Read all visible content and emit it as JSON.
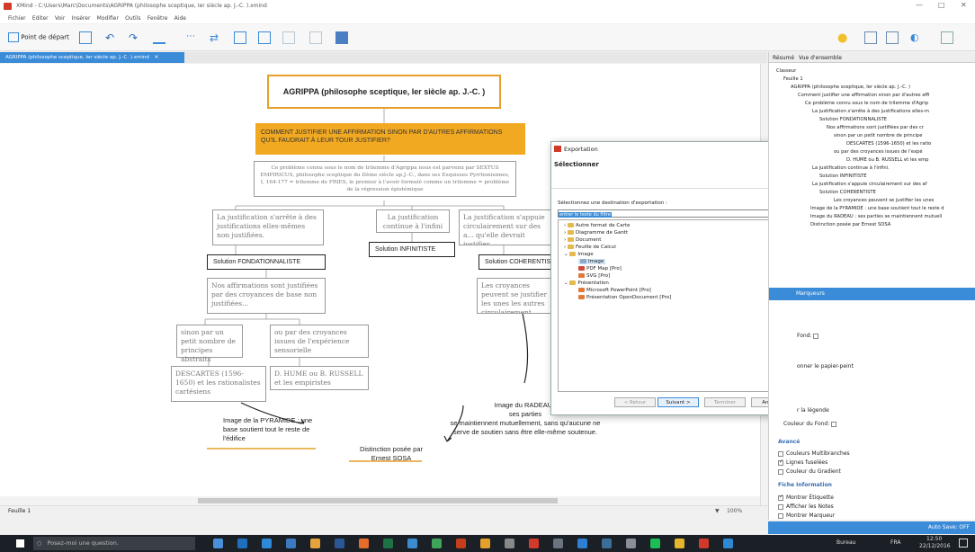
{
  "window": {
    "title": "XMind - C:\\Users\\Marc\\Documents\\AGRIPPA (philosophe sceptique, Ier siècle ap. J.-C. ).xmind"
  },
  "menu": [
    "Fichier",
    "Editer",
    "Voir",
    "Insérer",
    "Modifier",
    "Outils",
    "Fenêtre",
    "Aide"
  ],
  "toolbar": {
    "home_label": "Point de départ"
  },
  "doc_tab": "AGRIPPA (philosophe sceptique, Ier siècle ap. J.-C. ).xmind",
  "map": {
    "central": "AGRIPPA (philosophe sceptique, Ier siècle ap. J.-C. )",
    "question": "COMMENT JUSTIFIER UNE AFFIRMATION SINON PAR D'AUTRES AFFIRMATIONS QU'IL FAUDRAIT À LEUR TOUR JUSTIFIER?",
    "intro": "Ce problème connu sous le nom de trilemme d'Agrippa nous est parvenu par SEXTUS EMPIRICUS, philosophe sceptique du IIème siècle ap.J.-C., dans ses Esquisses Pyrrhoniennes, I, 164-177 = trilemme de FRIES, le premier à l'avoir formulé comme un trilemme = problème de la régression épistémique",
    "branch_left": "La justification s'arrête à des justifications elles-mêmes non justifiées.",
    "branch_mid": "La justification continue à l'infini",
    "branch_right": "La justification s'appuie circulairement sur des a... qu'elle devrait justifier.",
    "sol_fond": "Solution FONDATIONNALISTE",
    "sol_inf": "Solution INFINITISTE",
    "sol_coh": "Solution COHERENTISTE",
    "affirmations": "Nos affirmations sont justifiées par des croyances de base non justifiées...",
    "croyances": "Les croyances peuvent se justifier les unes les autres circulairement",
    "sinon": "sinon par un petit nombre de principes abstraits",
    "ou_par": "ou par des croyances issues de l'expérience sensorielle",
    "descartes": "DESCARTES (1596-1650) et les rationalistes cartésiens",
    "hume": "D. HUME ou B. RUSSELL et les empiristes",
    "pyramide": "Image de la PYRAMIDE : une base soutient tout le reste de l'édifice",
    "radeau_1": "Image du RADEAU : ses parties",
    "radeau_2": "se maintiennent mutuellement, sans qu'aucune ne serve de soutien sans être elle-même soutenue.",
    "sosa": "Distinction posée par Ernest SOSA"
  },
  "dialog": {
    "title": "Exportation",
    "heading": "Sélectionner",
    "prompt": "Sélectionnez une destination d'exportation :",
    "filter": "entrer le texte du filtre",
    "tree": [
      {
        "label": "Autre format de Carte",
        "level": 0,
        "type": "folder"
      },
      {
        "label": "Diagramme de Gantt",
        "level": 0,
        "type": "folder"
      },
      {
        "label": "Document",
        "level": 0,
        "type": "folder"
      },
      {
        "label": "Feuille de Calcul",
        "level": 0,
        "type": "folder"
      },
      {
        "label": "Image",
        "level": 0,
        "type": "folder-open"
      },
      {
        "label": "Image",
        "level": 1,
        "type": "item",
        "selected": true
      },
      {
        "label": "PDF Map [Pro]",
        "level": 1,
        "type": "item"
      },
      {
        "label": "SVG [Pro]",
        "level": 1,
        "type": "item"
      },
      {
        "label": "Présentation",
        "level": 0,
        "type": "folder-open"
      },
      {
        "label": "Microsoft PowerPoint [Pro]",
        "level": 1,
        "type": "item"
      },
      {
        "label": "Présentation OpenDocument [Pro]",
        "level": 1,
        "type": "item"
      }
    ],
    "buttons": {
      "back": "< Retour",
      "next": "Suivant >",
      "finish": "Terminer",
      "cancel": "Annuler"
    }
  },
  "right_panel": {
    "tabs": [
      "Résumé",
      "Vue d'ensemble"
    ],
    "tree": [
      {
        "label": "Classeur",
        "level": 0
      },
      {
        "label": "Feuille 1",
        "level": 1
      },
      {
        "label": "AGRIPPA (philosophe sceptique, Ier siècle ap. J.-C. )",
        "level": 2
      },
      {
        "label": "Comment justifier une affirmation sinon par d'autres affi",
        "level": 3
      },
      {
        "label": "Ce problème connu sous le nom de trilemme d'Agrip",
        "level": 4
      },
      {
        "label": "La justification s'arrête à des justifications elles-m",
        "level": 5
      },
      {
        "label": "Solution FONDATIONNALISTE",
        "level": 6
      },
      {
        "label": "Nos affirmations sont justifiées par des cr",
        "level": 7
      },
      {
        "label": "sinon par un petit nombre de principe",
        "level": 8
      },
      {
        "label": "DESCARTES (1596-1650) et les ratio",
        "level": 9
      },
      {
        "label": "ou par des croyances issues de l'expé",
        "level": 8
      },
      {
        "label": "D. HUME ou B. RUSSELL et les emp",
        "level": 9
      },
      {
        "label": "La justification continue à l'infini.",
        "level": 5
      },
      {
        "label": "Solution INFINITISTE",
        "level": 6
      },
      {
        "label": "La justification s'appuie circulairement sur des af",
        "level": 5
      },
      {
        "label": "Solution COHERENTISTE",
        "level": 6
      },
      {
        "label": "Les croyances peuvent se justifier les unes",
        "level": 7
      },
      {
        "label": "Image de la PYRAMIDE : une base soutient tout le reste d",
        "level": 3
      },
      {
        "label": "Image du RADEAU : ses parties se maintiennent mutuell",
        "level": 3
      },
      {
        "label": "Distinction posée par Ernest SOSA",
        "level": 3
      }
    ],
    "format_tab": "Marqueurs",
    "fond": "Fond:",
    "papier": "onner le papier-peint",
    "legende": "r la légende",
    "couleur_fond": "Couleur du Fond:",
    "avance": "Avancé",
    "opts": [
      {
        "label": "Couleurs Multibranches",
        "checked": false
      },
      {
        "label": "Lignes fuselées",
        "checked": true
      },
      {
        "label": "Couleur du Gradient",
        "checked": false
      }
    ],
    "fiche": "Fiche Information",
    "opts2": [
      {
        "label": "Montrer Étiquette",
        "checked": true
      },
      {
        "label": "Afficher les Notes",
        "checked": false
      },
      {
        "label": "Montrer Marqueur",
        "checked": false
      }
    ],
    "autosave": "Auto Save: OFF"
  },
  "status": {
    "sheet": "Feuille 1",
    "zoom": "100%"
  },
  "taskbar": {
    "search": "Posez-moi une question.",
    "desktop": "Bureau",
    "lang": "FRA",
    "time": "12:50",
    "date": "22/12/2016"
  }
}
